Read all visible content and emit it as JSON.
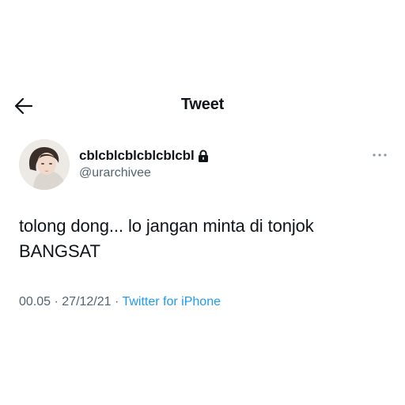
{
  "header": {
    "back_icon": "arrow-left-icon",
    "title": "Tweet"
  },
  "tweet": {
    "avatar_icon": "profile-photo",
    "display_name": "cblcblcblcblcblcbl",
    "lock_icon": "lock-icon",
    "handle": "@urarchivee",
    "more_icon": "more-horizontal-icon",
    "text_line1": "tolong dong... lo jangan minta di tonjok",
    "text_line2": "BANGSAT",
    "time": "00.05",
    "separator1": " · ",
    "date": "27/12/21",
    "separator2": " · ",
    "source": "Twitter for iPhone"
  },
  "colors": {
    "text_primary": "#0f1419",
    "text_secondary": "#536471",
    "accent": "#1d9bf0",
    "background": "#ffffff"
  }
}
